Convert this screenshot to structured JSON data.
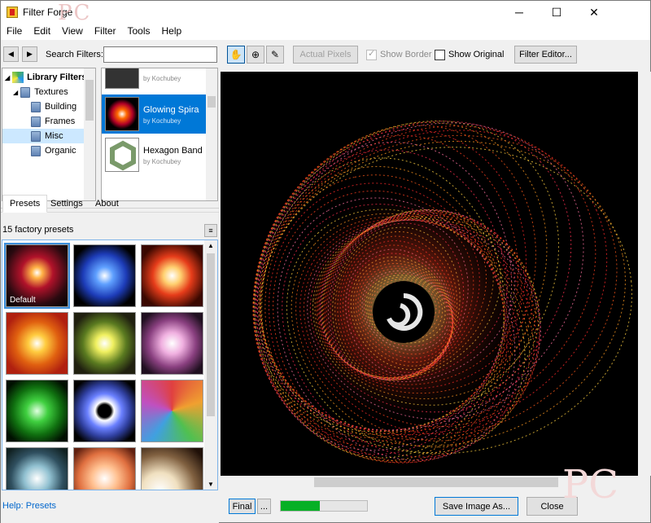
{
  "window": {
    "title": "Filter Forge",
    "watermark": "PC",
    "controls": {
      "minimize": "─",
      "maximize": "☐",
      "close": "✕"
    }
  },
  "menu": [
    "File",
    "Edit",
    "View",
    "Filter",
    "Tools",
    "Help"
  ],
  "search": {
    "label": "Search Filters:",
    "value": "",
    "placeholder": ""
  },
  "tree": {
    "items": [
      {
        "label": "Library Filters",
        "expanded": true
      },
      {
        "label": "Textures",
        "expanded": true
      },
      {
        "label": "Building"
      },
      {
        "label": "Frames"
      },
      {
        "label": "Misc",
        "selected": true
      },
      {
        "label": "Organic"
      }
    ]
  },
  "filters": {
    "items": [
      {
        "name": "",
        "author": "by Kochubey"
      },
      {
        "name": "Glowing Spira",
        "author": "by Kochubey",
        "selected": true
      },
      {
        "name": "Hexagon Band",
        "author": "by Kochubey"
      }
    ]
  },
  "tabs": [
    "Presets",
    "Settings",
    "About"
  ],
  "presets": {
    "count_text": "15 factory presets",
    "default_label": "Default",
    "colors": [
      "#7a1a22",
      "#1d57d8",
      "#e65a1a",
      "#e9a21b",
      "#c6d94a",
      "#d88ac8",
      "#2ea82e",
      "#5a6ed8",
      "#e7742e",
      "#7aa0b8",
      "#f09a6a",
      "#e8c9a0"
    ]
  },
  "help": {
    "text": "Help: Presets"
  },
  "toolbar": {
    "actual_pixels": "Actual Pixels",
    "show_border": "Show Border",
    "show_border_checked": true,
    "show_original": "Show Original",
    "show_original_checked": false,
    "filter_editor": "Filter Editor..."
  },
  "bottom": {
    "final": "Final",
    "more": "...",
    "progress": 0.45,
    "save": "Save Image As...",
    "close": "Close"
  },
  "corner_watermark": "PC"
}
